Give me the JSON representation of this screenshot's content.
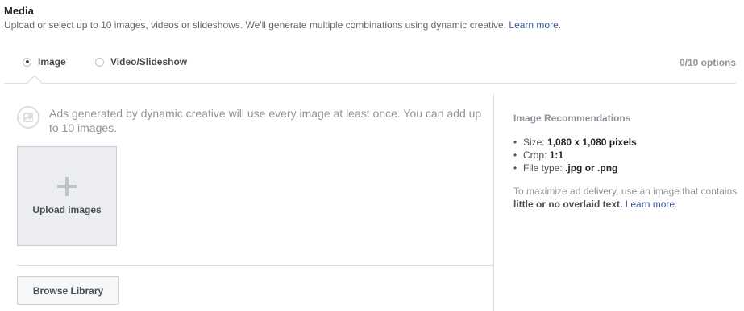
{
  "media": {
    "title": "Media",
    "description": "Upload or select up to 10 images, videos or slideshows. We'll generate multiple combinations using dynamic creative.",
    "learn_more": "Learn more."
  },
  "format_options": {
    "image_label": "Image",
    "image_selected": true,
    "video_label": "Video/Slideshow",
    "video_selected": false,
    "count_text": "0/10 options"
  },
  "upload": {
    "info_text": "Ads generated by dynamic creative will use every image at least once. You can add up to 10 images.",
    "upload_label": "Upload images",
    "browse_label": "Browse Library"
  },
  "recommendations": {
    "title": "Image Recommendations",
    "items": [
      {
        "label": "Size:",
        "value": "1,080 x 1,080 pixels"
      },
      {
        "label": "Crop:",
        "value": "1:1"
      },
      {
        "label": "File type:",
        "value": ".jpg or .png"
      }
    ],
    "note_prefix": "To maximize ad delivery, use an image that contains",
    "note_bold": "little or no overlaid text.",
    "note_link": "Learn more."
  },
  "colors": {
    "link": "#385898",
    "muted_text": "#90949c",
    "border": "#dddfe2"
  },
  "icons": {
    "info": "image-placeholder-icon",
    "upload": "plus-icon"
  }
}
